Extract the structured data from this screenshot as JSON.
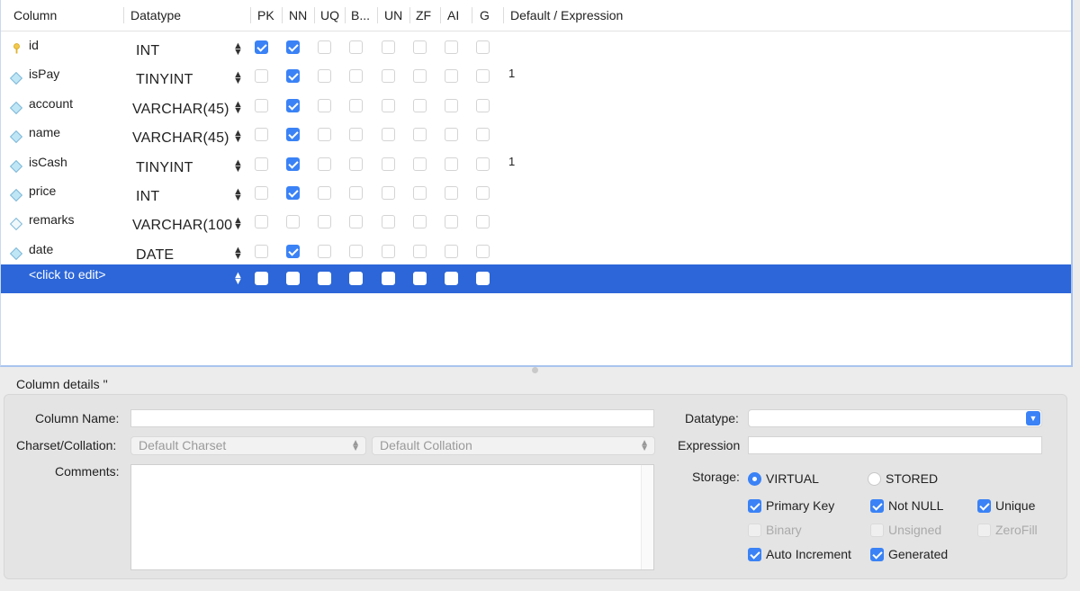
{
  "grid": {
    "headers": {
      "column": "Column",
      "datatype": "Datatype",
      "pk": "PK",
      "nn": "NN",
      "uq": "UQ",
      "b": "B...",
      "un": "UN",
      "zf": "ZF",
      "ai": "AI",
      "g": "G",
      "default": "Default / Expression"
    },
    "rows": [
      {
        "name": "id",
        "datatype": "INT",
        "icon": "primary-key-icon",
        "flags": [
          true,
          true,
          false,
          false,
          false,
          false,
          false,
          false
        ],
        "default": ""
      },
      {
        "name": "isPay",
        "datatype": "TINYINT",
        "icon": "column-diamond-icon",
        "flags": [
          false,
          true,
          false,
          false,
          false,
          false,
          false,
          false
        ],
        "default": "1"
      },
      {
        "name": "account",
        "datatype": "VARCHAR(45)",
        "icon": "column-diamond-icon",
        "flags": [
          false,
          true,
          false,
          false,
          false,
          false,
          false,
          false
        ],
        "default": ""
      },
      {
        "name": "name",
        "datatype": "VARCHAR(45)",
        "icon": "column-diamond-icon",
        "flags": [
          false,
          true,
          false,
          false,
          false,
          false,
          false,
          false
        ],
        "default": ""
      },
      {
        "name": "isCash",
        "datatype": "TINYINT",
        "icon": "column-diamond-icon",
        "flags": [
          false,
          true,
          false,
          false,
          false,
          false,
          false,
          false
        ],
        "default": "1"
      },
      {
        "name": "price",
        "datatype": "INT",
        "icon": "column-diamond-icon",
        "flags": [
          false,
          true,
          false,
          false,
          false,
          false,
          false,
          false
        ],
        "default": ""
      },
      {
        "name": "remarks",
        "datatype": "VARCHAR(100",
        "icon": "nullable-column-diamond-icon",
        "flags": [
          false,
          false,
          false,
          false,
          false,
          false,
          false,
          false
        ],
        "default": ""
      },
      {
        "name": "date",
        "datatype": "DATE",
        "icon": "column-diamond-icon",
        "flags": [
          false,
          true,
          false,
          false,
          false,
          false,
          false,
          false
        ],
        "default": ""
      }
    ],
    "new_row": {
      "name": "<click to edit>"
    }
  },
  "details": {
    "title": "Column details ''",
    "column_name_label": "Column Name:",
    "column_name_value": "",
    "charset_label": "Charset/Collation:",
    "charset_placeholder": "Default Charset",
    "collation_placeholder": "Default Collation",
    "comments_label": "Comments:",
    "datatype_label": "Datatype:",
    "datatype_value": "",
    "expression_label": "Expression",
    "expression_value": "",
    "storage_label": "Storage:",
    "storage_virtual": "VIRTUAL",
    "storage_stored": "STORED",
    "storage_selected": "VIRTUAL",
    "options": {
      "primary_key": "Primary Key",
      "not_null": "Not NULL",
      "unique": "Unique",
      "binary": "Binary",
      "unsigned": "Unsigned",
      "zerofill": "ZeroFill",
      "auto_increment": "Auto Increment",
      "generated": "Generated"
    },
    "accent_color": "#3a82f6",
    "selection_color": "#2c66d8"
  }
}
